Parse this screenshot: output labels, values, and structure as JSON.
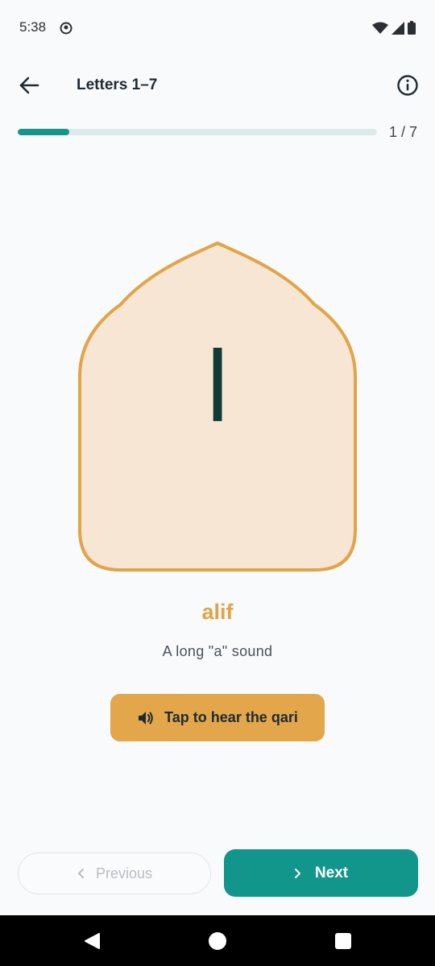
{
  "status_bar": {
    "time": "5:38",
    "icons": [
      "app-notification-icon",
      "wifi-icon",
      "signal-icon",
      "battery-icon"
    ]
  },
  "app_bar": {
    "title": "Letters 1–7",
    "back_icon": "arrow-left-icon",
    "info_icon": "info-icon"
  },
  "progress": {
    "current": 1,
    "total": 7,
    "label": "1 / 7"
  },
  "card": {
    "letter": "ا",
    "fill_color": "#f7e6d4",
    "border_color": "#e2a447"
  },
  "letter": {
    "name": "alif",
    "description": "A long \"a\" sound"
  },
  "audio_button": {
    "label": "Tap to hear the qari",
    "icon": "speaker-icon"
  },
  "navigation": {
    "previous_label": "Previous",
    "next_label": "Next"
  },
  "colors": {
    "accent": "#12958a",
    "gold": "#e3a64a",
    "background": "#f8fafb"
  }
}
